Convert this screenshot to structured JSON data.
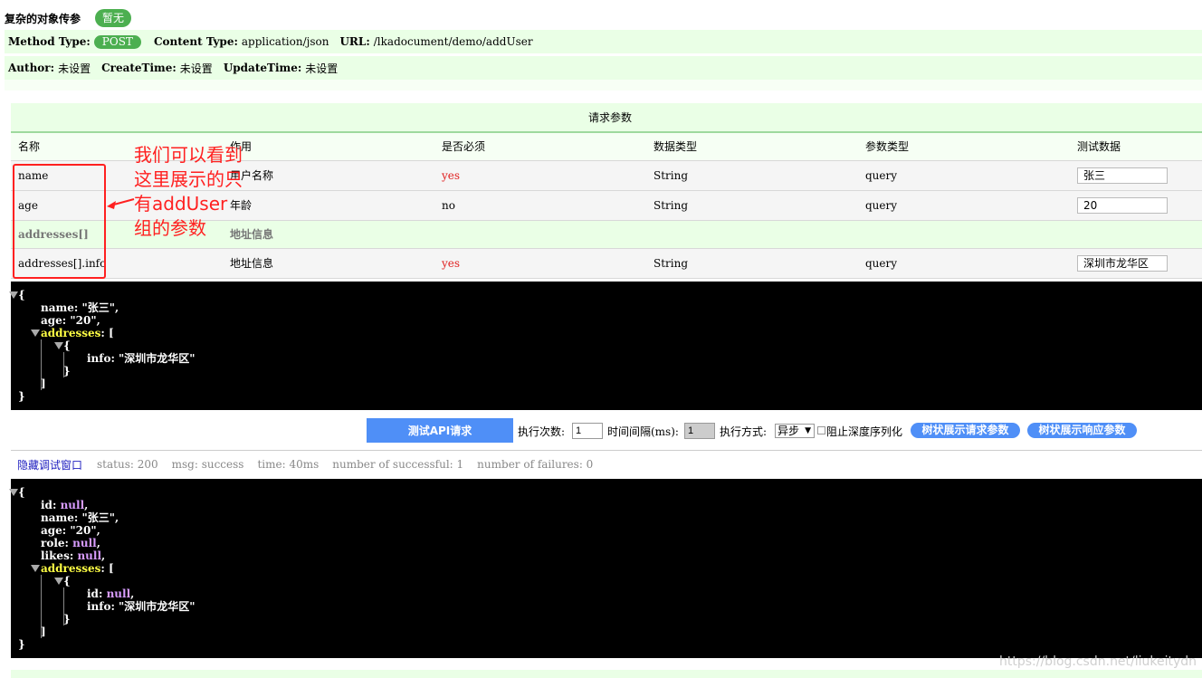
{
  "header": {
    "title": "复杂的对象传参",
    "badge": "暂无"
  },
  "meta": {
    "method_type_label": "Method Type:",
    "method": "POST",
    "content_type_label": "Content Type:",
    "content_type": "application/json",
    "url_label": "URL:",
    "url": "/lkadocument/demo/addUser",
    "author_label": "Author:",
    "author": "未设置",
    "create_time_label": "CreateTime:",
    "create_time": "未设置",
    "update_time_label": "UpdateTime:",
    "update_time": "未设置"
  },
  "params": {
    "section_title": "请求参数",
    "columns": [
      "名称",
      "作用",
      "是否必须",
      "数据类型",
      "参数类型",
      "测试数据"
    ],
    "rows": [
      {
        "name": "name",
        "desc": "用户名称",
        "required": "yes",
        "data_type": "String",
        "param_type": "query",
        "test_value": "张三"
      },
      {
        "name": "age",
        "desc": "年龄",
        "required": "no",
        "data_type": "String",
        "param_type": "query",
        "test_value": "20"
      }
    ],
    "group": {
      "name": "addresses[]",
      "desc": "地址信息"
    },
    "group_rows": [
      {
        "name": "addresses[].info",
        "desc": "地址信息",
        "required": "yes",
        "data_type": "String",
        "param_type": "query",
        "test_value": "深圳市龙华区"
      }
    ]
  },
  "request_json": {
    "open": "{",
    "l1": "name: \"张三\",",
    "l2": "age: \"20\",",
    "l3_key": "addresses",
    "l3_rest": ": [",
    "l4": "{",
    "l5": "info: \"深圳市龙华区\"",
    "l6": "}",
    "l7": "]",
    "close": "}"
  },
  "controls": {
    "test_button": "测试API请求",
    "exec_count_label": "执行次数:",
    "exec_count": "1",
    "interval_label": "时间间隔(ms):",
    "interval": "1",
    "mode_label": "执行方式:",
    "mode": "异步",
    "deep_serial_label": "阻止深度序列化",
    "tree_request_button": "树状展示请求参数",
    "tree_response_button": "树状展示响应参数"
  },
  "status": {
    "hide_link": "隐藏调试窗口",
    "status": "status: 200",
    "msg": "msg: success",
    "time": "time: 40ms",
    "success_count": "number of successful: 1",
    "failure_count": "number of failures: 0"
  },
  "response_json": {
    "open": "{",
    "id_key": "id: ",
    "id_val": "null",
    "name": "name: \"张三\",",
    "age": "age: \"20\",",
    "role_key": "role: ",
    "role_val": "null",
    "likes_key": "likes: ",
    "likes_val": "null",
    "addresses_key": "addresses",
    "addresses_rest": ": [",
    "inner_open": "{",
    "inner_id_key": "id: ",
    "inner_id_val": "null",
    "inner_info": "info: \"深圳市龙华区\"",
    "inner_close": "}",
    "arr_close": "]",
    "close": "}"
  },
  "annotation": {
    "text": "我们可以看到这里展示的只有addUser组的参数"
  },
  "watermark": "https://blog.csdn.net/liukeitydn"
}
